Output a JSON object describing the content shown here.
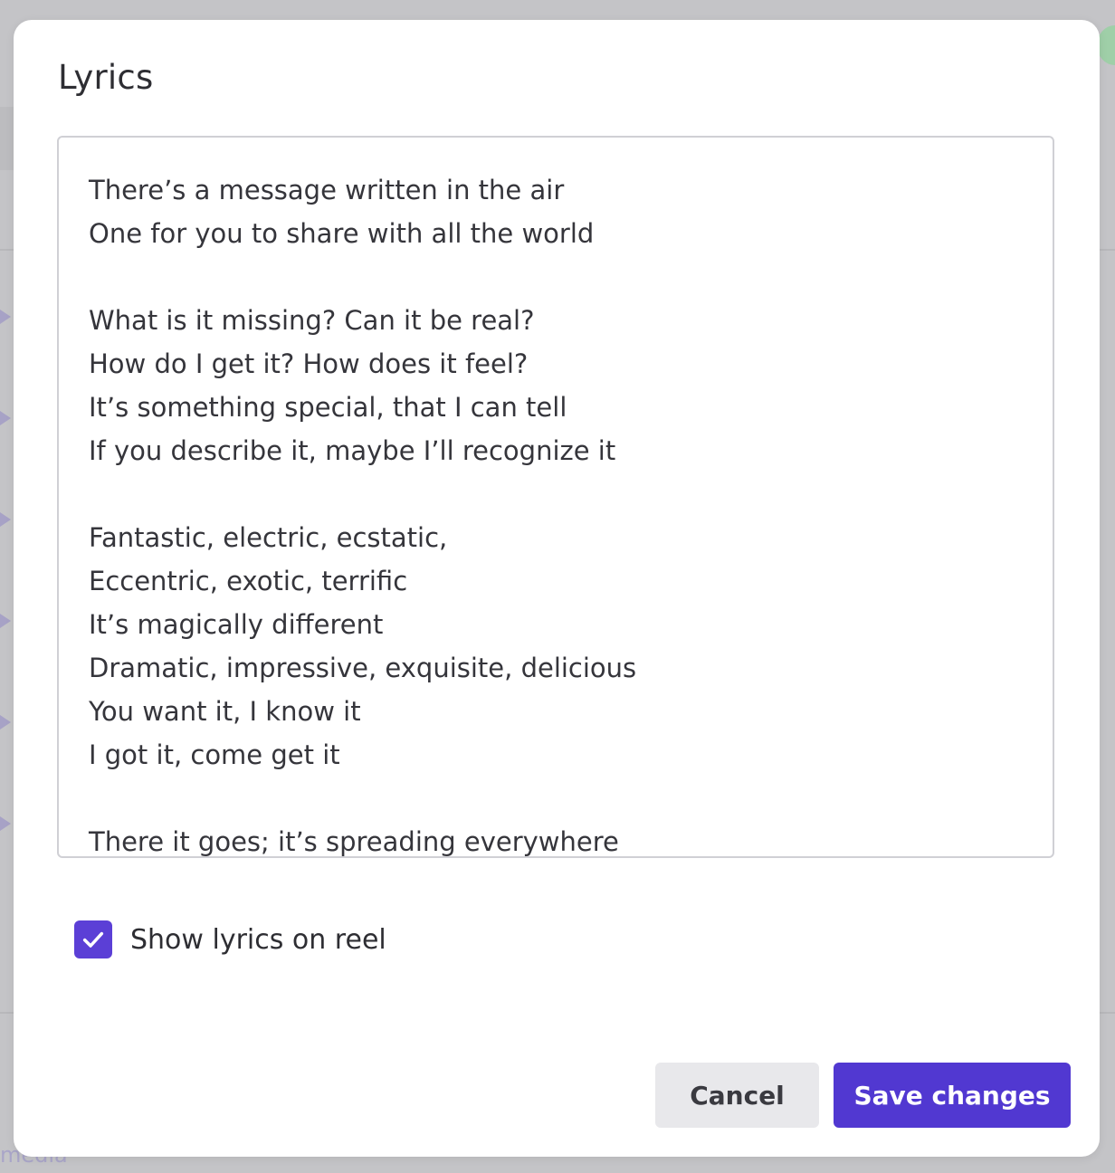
{
  "modal": {
    "title": "Lyrics",
    "lyrics": "There’s a message written in the air\nOne for you to share with all the world\n\nWhat is it missing? Can it be real?\nHow do I get it? How does it feel?\nIt’s something special, that I can tell\nIf you describe it, maybe I’ll recognize it\n\nFantastic, electric, ecstatic,\nEccentric, exotic, terrific\nIt’s magically different\nDramatic, impressive, exquisite, delicious\nYou want it, I know it\nI got it, come get it\n\nThere it goes; it’s spreading everywhere",
    "show_lyrics_checkbox": {
      "label": "Show lyrics on reel",
      "checked": true
    },
    "buttons": {
      "cancel": "Cancel",
      "save": "Save changes"
    }
  },
  "background": {
    "partial_label": "media"
  },
  "colors": {
    "accent": "#5138d1",
    "checkbox": "#5b3fd6",
    "cancel_bg": "#e8e8eb",
    "text": "#2e2e33"
  },
  "icons": {
    "checkbox": "checkmark-icon"
  }
}
